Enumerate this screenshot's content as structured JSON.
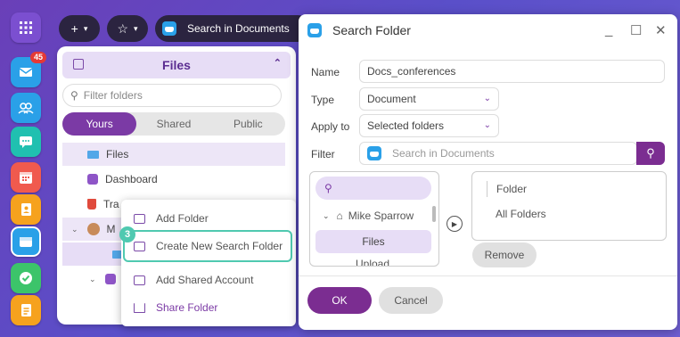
{
  "appbar": {
    "mail_badge": "45"
  },
  "topbar": {
    "search_label": "Search in Documents"
  },
  "files_panel": {
    "title": "Files",
    "filter_placeholder": "Filter folders",
    "tabs": [
      "Yours",
      "Shared",
      "Public"
    ],
    "tree": [
      {
        "label": "Files"
      },
      {
        "label": "Dashboard"
      },
      {
        "label": "Tra"
      },
      {
        "label": "M"
      }
    ]
  },
  "context_menu": {
    "step_number": "3",
    "items": [
      {
        "label": "Add Folder"
      },
      {
        "label": "Create New Search Folder"
      },
      {
        "label": "Add Shared Account"
      },
      {
        "label": "Share Folder"
      }
    ]
  },
  "dialog": {
    "title": "Search Folder",
    "name_label": "Name",
    "name_value": "Docs_conferences",
    "type_label": "Type",
    "type_value": "Document",
    "apply_label": "Apply to",
    "apply_value": "Selected folders",
    "filter_label": "Filter",
    "filter_placeholder": "Search in Documents",
    "account": "Mike Sparrow",
    "tree_items": [
      "Files",
      "Upload"
    ],
    "list_header": "Folder",
    "list_items": [
      "All Folders"
    ],
    "remove_label": "Remove",
    "ok_label": "OK",
    "cancel_label": "Cancel"
  },
  "colors": {
    "accent": "#7b2d91",
    "highlight": "#4fc9b0",
    "primary_dark": "#2b2440"
  }
}
